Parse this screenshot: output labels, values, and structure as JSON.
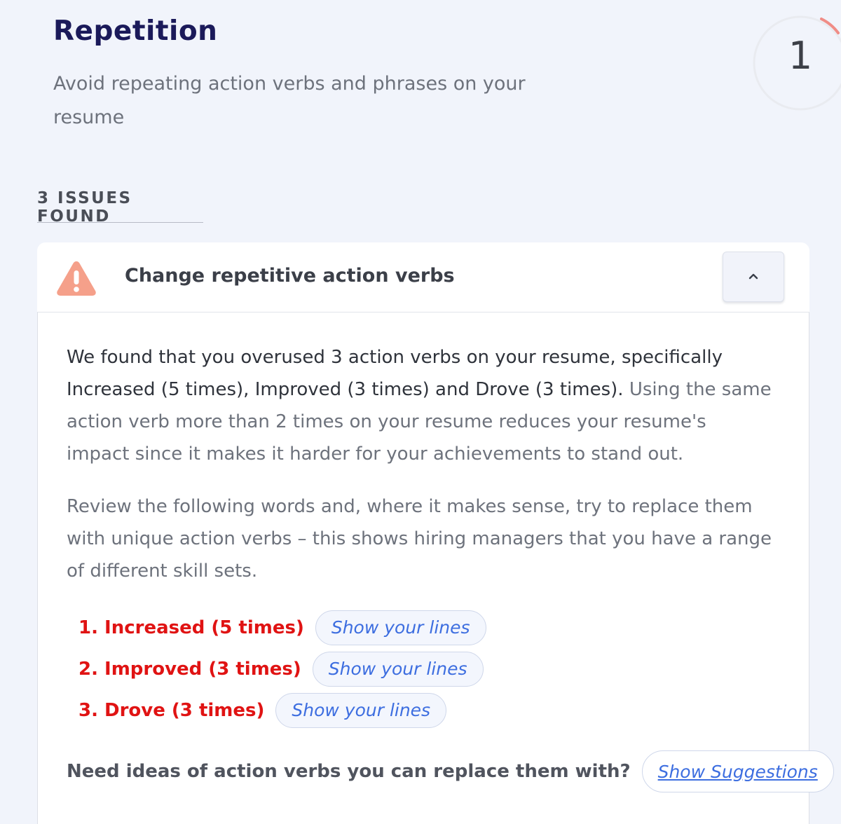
{
  "header": {
    "title": "Repetition",
    "subtitle": "Avoid repeating action verbs and phrases on your resume",
    "score": "1",
    "score_color": "#f08c86"
  },
  "issues": {
    "heading": "3 ISSUES FOUND"
  },
  "card": {
    "icon": "warning-triangle-icon",
    "icon_color": "#f5a08a",
    "title": "Change repetitive action verbs",
    "collapse_icon": "chevron-up-icon",
    "paragraph1_strong": "We found that you overused 3 action verbs on your resume, specifically Increased (5 times), Improved (3 times) and Drove (3 times).",
    "paragraph1_rest": " Using the same action verb more than 2 times on your resume reduces your resume's impact since it makes it harder for your achievements to stand out.",
    "paragraph2": "Review the following words and, where it makes sense, try to replace them with unique action verbs – this shows hiring managers that you have a range of different skill sets.",
    "verbs": [
      {
        "label": "1. Increased (5 times)",
        "button": "Show your lines"
      },
      {
        "label": "2. Improved (3 times)",
        "button": "Show your lines"
      },
      {
        "label": "3. Drove (3 times)",
        "button": "Show your lines"
      }
    ],
    "footer_question": "Need ideas of action verbs you can replace them with?",
    "suggestions_button": "Show Suggestions",
    "accent_color": "#3d6ee0",
    "verb_color": "#e01313"
  }
}
